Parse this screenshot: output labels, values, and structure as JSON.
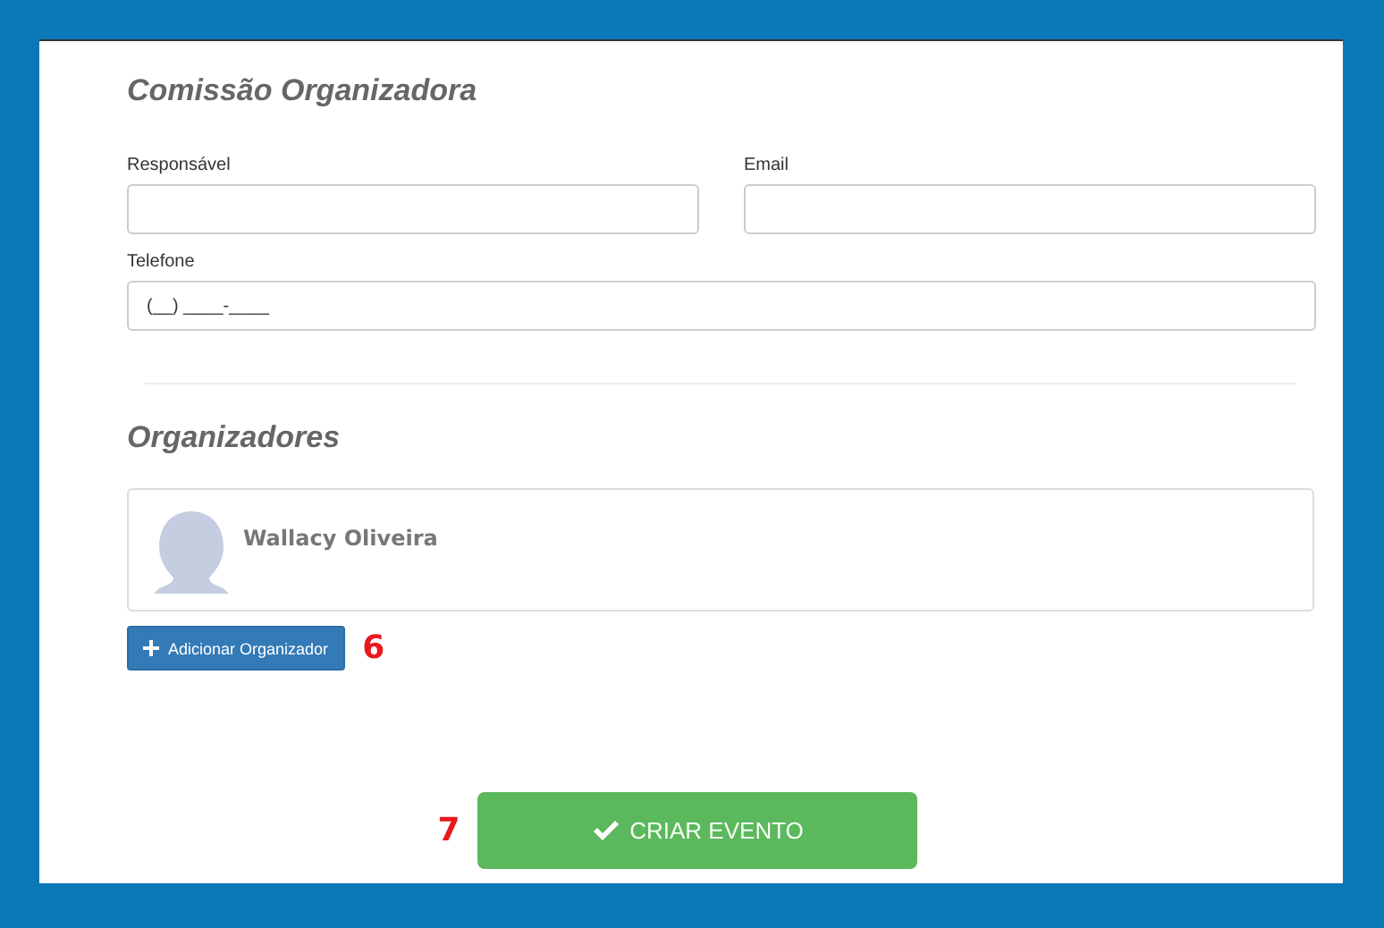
{
  "section_title": "Comissão Organizadora",
  "fields": [
    {
      "label": "Responsável"
    },
    {
      "label": "Email"
    },
    {
      "label": "Telefone",
      "value": "(__) ____-____"
    }
  ],
  "organizers_title": "Organizadores",
  "organizers": [
    {
      "name": "Wallacy Oliveira"
    }
  ],
  "add_button": {
    "label": "Adicionar Organizador",
    "step": "6"
  },
  "submit_button": {
    "label": "CRIAR EVENTO",
    "step": "7"
  }
}
